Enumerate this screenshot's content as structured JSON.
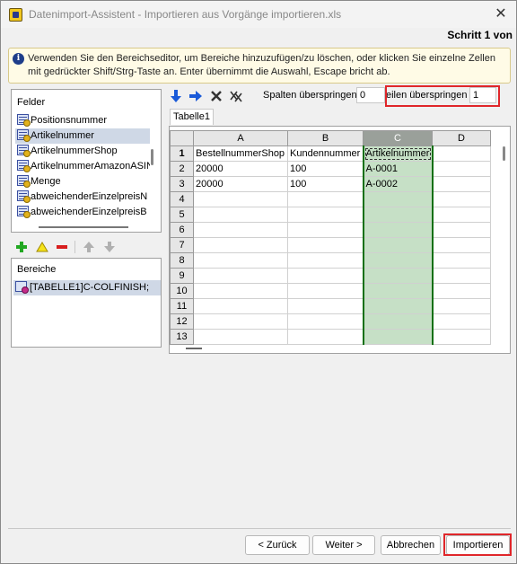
{
  "window": {
    "title": "Datenimport-Assistent -  Importieren aus  Vorgänge importieren.xls",
    "close_glyph": "✕",
    "step": "Schritt 1 von"
  },
  "info": {
    "text": "Verwenden Sie den Bereichseditor, um Bereiche hinzuzufügen/zu löschen, oder klicken Sie einzelne Zellen mit gedrückter Shift/Strg-Taste an. Enter übernimmt die Auswahl, Escape bricht ab."
  },
  "fields": {
    "title": "Felder",
    "items": [
      "Positionsnummer",
      "Artikelnummer",
      "ArtikelnummerShop",
      "ArtikelnummerAmazonASIN",
      "Menge",
      "abweichenderEinzelpreisN",
      "abweichenderEinzelpreisB"
    ],
    "selected_index": 1
  },
  "areas": {
    "title": "Bereiche",
    "items": [
      "[TABELLE1]C-COLFINISH;"
    ]
  },
  "toolbar": {
    "skip_columns_label": "Spalten überspringen",
    "skip_columns_value": "0",
    "skip_rows_label": "eilen überspringen",
    "skip_rows_value": "1"
  },
  "sheet": {
    "tab": "Tabelle1",
    "columns": [
      "A",
      "B",
      "C",
      "D"
    ],
    "selected_column": "C",
    "rows": [
      {
        "num": "1",
        "cells": [
          "BestellnummerShop",
          "Kundennummer",
          "Artikelnummer",
          ""
        ]
      },
      {
        "num": "2",
        "cells": [
          "20000",
          "100",
          "A-0001",
          ""
        ]
      },
      {
        "num": "3",
        "cells": [
          "20000",
          "100",
          "A-0002",
          ""
        ]
      },
      {
        "num": "4",
        "cells": [
          "",
          "",
          "",
          ""
        ]
      },
      {
        "num": "5",
        "cells": [
          "",
          "",
          "",
          ""
        ]
      },
      {
        "num": "6",
        "cells": [
          "",
          "",
          "",
          ""
        ]
      },
      {
        "num": "7",
        "cells": [
          "",
          "",
          "",
          ""
        ]
      },
      {
        "num": "8",
        "cells": [
          "",
          "",
          "",
          ""
        ]
      },
      {
        "num": "9",
        "cells": [
          "",
          "",
          "",
          ""
        ]
      },
      {
        "num": "10",
        "cells": [
          "",
          "",
          "",
          ""
        ]
      },
      {
        "num": "11",
        "cells": [
          "",
          "",
          "",
          ""
        ]
      },
      {
        "num": "12",
        "cells": [
          "",
          "",
          "",
          ""
        ]
      },
      {
        "num": "13",
        "cells": [
          "",
          "",
          "",
          ""
        ]
      }
    ]
  },
  "buttons": {
    "back": "< Zurück",
    "next": "Weiter >",
    "cancel": "Abbrechen",
    "import": "Importieren"
  },
  "colors": {
    "highlight": "#e0262a",
    "selection_fill": "#c6e0c6",
    "selection_border": "#107010"
  }
}
